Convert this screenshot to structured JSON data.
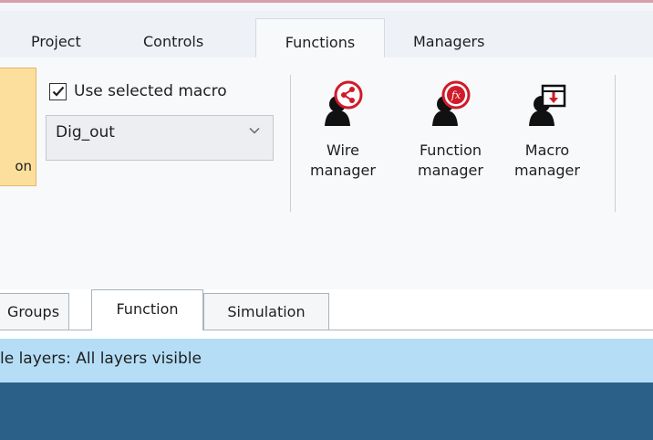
{
  "ribbon": {
    "tabs": [
      {
        "label": "Project"
      },
      {
        "label": "Controls"
      },
      {
        "label": "Functions",
        "active": true
      },
      {
        "label": "Managers"
      }
    ],
    "partial_button_label": "on",
    "use_selected_macro": {
      "label": "Use selected macro",
      "checked": true
    },
    "macro_select": {
      "value": "Dig_out"
    },
    "managers": [
      {
        "line1": "Wire",
        "line2": "manager",
        "icon": "wire-manager-icon"
      },
      {
        "line1": "Function",
        "line2": "manager",
        "icon": "function-manager-icon"
      },
      {
        "line1": "Macro",
        "line2": "manager",
        "icon": "macro-manager-icon"
      }
    ]
  },
  "doc_tabs": [
    {
      "label": "Groups"
    },
    {
      "label": "Function",
      "active": true
    },
    {
      "label": "Simulation"
    }
  ],
  "status": {
    "layers_text": "le layers: All layers visible"
  },
  "colors": {
    "accent_orange": "#fcdf9c",
    "status_blue": "#b5def6",
    "bottom_bar": "#2b6089",
    "icon_red": "#d11a2a"
  }
}
